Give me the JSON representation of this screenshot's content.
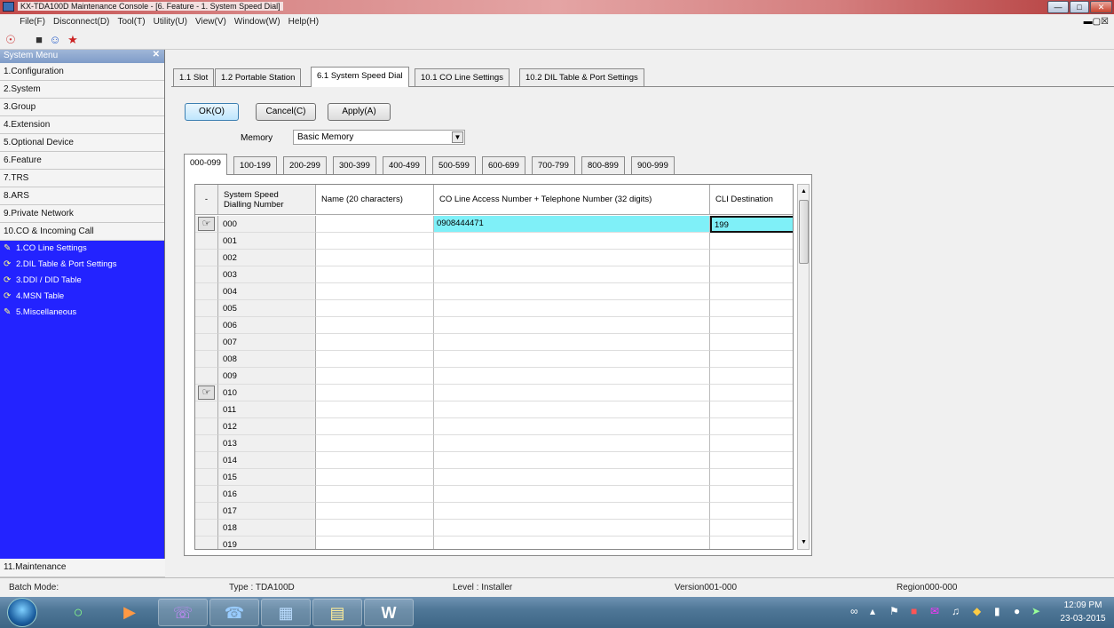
{
  "window": {
    "title": "KX-TDA100D Maintenance Console - [6. Feature - 1. System Speed Dial]"
  },
  "menu": [
    "File(F)",
    "Disconnect(D)",
    "Tool(T)",
    "Utility(U)",
    "View(V)",
    "Window(W)",
    "Help(H)"
  ],
  "sidebar": {
    "header": "System Menu",
    "items": [
      "1.Configuration",
      "2.System",
      "3.Group",
      "4.Extension",
      "5.Optional Device",
      "6.Feature",
      "7.TRS",
      "8.ARS",
      "9.Private Network",
      "10.CO & Incoming Call"
    ],
    "subitems": [
      "1.CO Line Settings",
      "2.DIL Table & Port Settings",
      "3.DDI / DID Table",
      "4.MSN Table",
      "5.Miscellaneous"
    ],
    "bottom_item": "11.Maintenance"
  },
  "tabs": [
    "1.1 Slot",
    "1.2 Portable Station",
    "6.1 System Speed Dial",
    "10.1 CO Line Settings",
    "10.2 DIL Table & Port Settings"
  ],
  "buttons": {
    "ok": "OK(O)",
    "cancel": "Cancel(C)",
    "apply": "Apply(A)"
  },
  "memory": {
    "label": "Memory",
    "value": "Basic Memory"
  },
  "range_tabs": [
    "000-099",
    "100-199",
    "200-299",
    "300-399",
    "400-499",
    "500-599",
    "600-699",
    "700-799",
    "800-899",
    "900-999"
  ],
  "grid": {
    "headers": {
      "num1": "System Speed",
      "num2": "Dialling Number",
      "name": "Name (20 characters)",
      "co": "CO Line Access Number + Telephone Number (32 digits)",
      "cli": "CLI Destination"
    },
    "rows": [
      {
        "num": "000",
        "name": "",
        "co": "0908444471",
        "cli": "199"
      },
      {
        "num": "001",
        "name": "",
        "co": "",
        "cli": ""
      },
      {
        "num": "002",
        "name": "",
        "co": "",
        "cli": ""
      },
      {
        "num": "003",
        "name": "",
        "co": "",
        "cli": ""
      },
      {
        "num": "004",
        "name": "",
        "co": "",
        "cli": ""
      },
      {
        "num": "005",
        "name": "",
        "co": "",
        "cli": ""
      },
      {
        "num": "006",
        "name": "",
        "co": "",
        "cli": ""
      },
      {
        "num": "007",
        "name": "",
        "co": "",
        "cli": ""
      },
      {
        "num": "008",
        "name": "",
        "co": "",
        "cli": ""
      },
      {
        "num": "009",
        "name": "",
        "co": "",
        "cli": ""
      },
      {
        "num": "010",
        "name": "",
        "co": "",
        "cli": ""
      },
      {
        "num": "011",
        "name": "",
        "co": "",
        "cli": ""
      },
      {
        "num": "012",
        "name": "",
        "co": "",
        "cli": ""
      },
      {
        "num": "013",
        "name": "",
        "co": "",
        "cli": ""
      },
      {
        "num": "014",
        "name": "",
        "co": "",
        "cli": ""
      },
      {
        "num": "015",
        "name": "",
        "co": "",
        "cli": ""
      },
      {
        "num": "016",
        "name": "",
        "co": "",
        "cli": ""
      },
      {
        "num": "017",
        "name": "",
        "co": "",
        "cli": ""
      },
      {
        "num": "018",
        "name": "",
        "co": "",
        "cli": ""
      },
      {
        "num": "019",
        "name": "",
        "co": "",
        "cli": ""
      }
    ]
  },
  "status": {
    "batch": "Batch Mode:",
    "type": "Type : TDA100D",
    "level": "Level : Installer",
    "version": "Version001-000",
    "region": "Region000-000"
  },
  "clock": {
    "time": "12:09 PM",
    "date": "23-03-2015"
  },
  "icons": {
    "hand": "pointer-hand-icon",
    "dropdown": "chevron-down-icon"
  },
  "colors": {
    "sidebar": "#2323ff",
    "selected_cell": "#7ff0f8"
  }
}
